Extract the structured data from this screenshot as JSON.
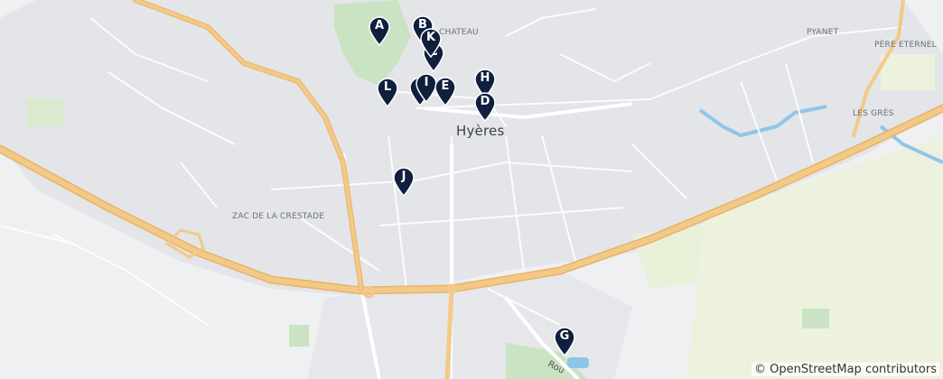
{
  "map": {
    "colors": {
      "background": "#eef0f2",
      "built_area": "#e3e5e8",
      "park": "#c9e3c3",
      "field": "#eaf1d9",
      "water": "#8fc6e8",
      "highway": "#f2c987",
      "highway_edge": "#e7b468",
      "street": "#ffffff",
      "marker": "#0f1f3d"
    },
    "places": {
      "city": "Hyères",
      "chateau": "CHATEAU",
      "pyanet": "PYANET",
      "pere_eternel": "PÈRE ETERNEL",
      "les_gres": "LES GRÈS",
      "zac": "ZAC DE LA CRESTADE"
    },
    "road_label": "Rou",
    "markers": [
      {
        "label": "A"
      },
      {
        "label": "B"
      },
      {
        "label": "K"
      },
      {
        "label": "C"
      },
      {
        "label": "H"
      },
      {
        "label": "D"
      },
      {
        "label": "L"
      },
      {
        "label": "I"
      },
      {
        "label": "E"
      },
      {
        "label": "J"
      },
      {
        "label": "G"
      }
    ],
    "attribution": "© OpenStreetMap contributors"
  }
}
